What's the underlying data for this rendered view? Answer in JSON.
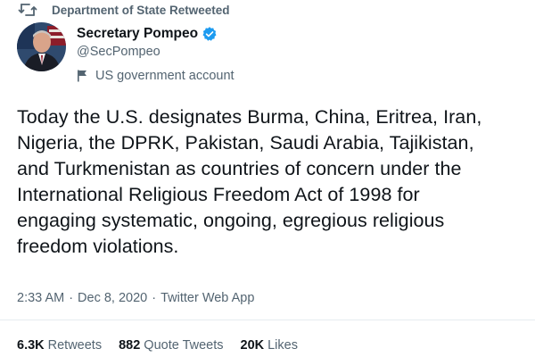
{
  "retweet_context": {
    "icon": "retweet-icon",
    "text": "Department of State Retweeted"
  },
  "author": {
    "display_name": "Secretary Pompeo",
    "handle": "@SecPompeo",
    "verified": true,
    "verified_icon": "verified-badge-icon",
    "label_icon": "flag-icon",
    "label_text": "US government account",
    "verified_color": "#1d9bf0"
  },
  "tweet": {
    "lines": [
      "Today the U.S. designates Burma, China, Eritrea, Iran,",
      "Nigeria, the DPRK, Pakistan, Saudi Arabia, Tajikistan,",
      "and Turkmenistan as countries of concern under the",
      "International Religious Freedom Act of 1998 for",
      "engaging systematic, ongoing, egregious religious",
      "freedom violations."
    ]
  },
  "meta": {
    "time": "2:33 AM",
    "separator": "·",
    "date": "Dec 8, 2020",
    "source": "Twitter Web App"
  },
  "stats": {
    "retweets_count": "6.3K",
    "retweets_label": "Retweets",
    "quote_count": "882",
    "quote_label": "Quote Tweets",
    "likes_count": "20K",
    "likes_label": "Likes"
  },
  "colors": {
    "text_primary": "#0f1419",
    "text_secondary": "#536471",
    "divider": "#e6ecf0"
  }
}
